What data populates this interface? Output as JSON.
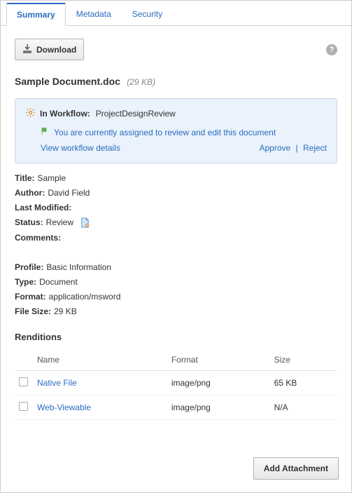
{
  "tabs": {
    "summary": "Summary",
    "metadata": "Metadata",
    "security": "Security"
  },
  "toolbar": {
    "download": "Download"
  },
  "doc": {
    "name": "Sample Document.doc",
    "size_label": "(29 KB)"
  },
  "workflow": {
    "label": "In Workflow:",
    "name": "ProjectDesignReview",
    "message": "You are currently assigned to review and edit this document",
    "details_link": "View workflow details",
    "approve": "Approve",
    "reject": "Reject"
  },
  "fields": {
    "title_k": "Title:",
    "title_v": "Sample",
    "author_k": "Author:",
    "author_v": "David Field",
    "lastmod_k": "Last Modified:",
    "lastmod_v": "",
    "status_k": "Status:",
    "status_v": "Review",
    "comments_k": "Comments:",
    "comments_v": "",
    "profile_k": "Profile:",
    "profile_v": "Basic Information",
    "type_k": "Type:",
    "type_v": "Document",
    "format_k": "Format:",
    "format_v": "application/msword",
    "filesize_k": "File Size:",
    "filesize_v": "29 KB"
  },
  "renditions": {
    "title": "Renditions",
    "headers": {
      "name": "Name",
      "format": "Format",
      "size": "Size"
    },
    "rows": [
      {
        "name": "Native File",
        "format": "image/png",
        "size": "65 KB"
      },
      {
        "name": "Web-Viewable",
        "format": "image/png",
        "size": "N/A"
      }
    ]
  },
  "footer": {
    "add_attachment": "Add Attachment"
  }
}
